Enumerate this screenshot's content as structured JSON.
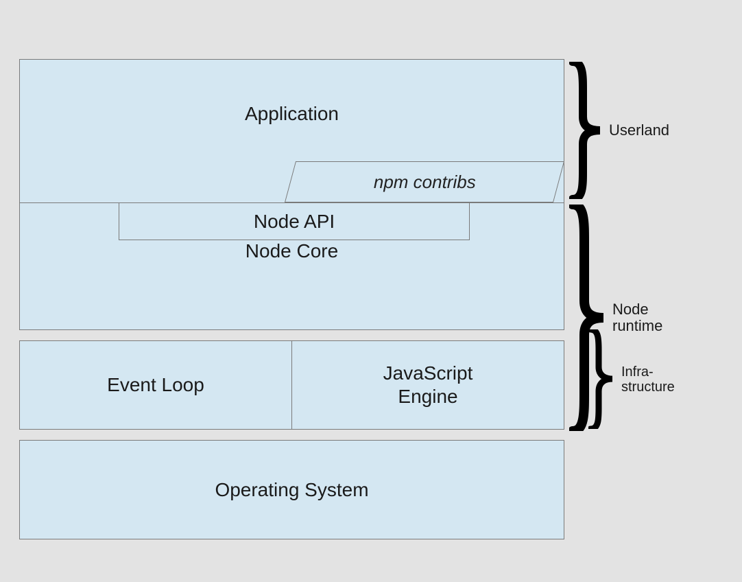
{
  "layers": {
    "application": "Application",
    "npm": "npm contribs",
    "node_api": "Node API",
    "node_core": "Node Core",
    "event_loop": "Event Loop",
    "js_engine": "JavaScript\nEngine",
    "os": "Operating System"
  },
  "annotations": {
    "userland": "Userland",
    "runtime": "Node\nruntime",
    "infra": "Infra-\nstructure"
  },
  "colors": {
    "box_fill": "#d4e7f2",
    "box_border": "#7a7a7a",
    "page_bg": "#e3e3e3",
    "text": "#1a1a1a"
  }
}
